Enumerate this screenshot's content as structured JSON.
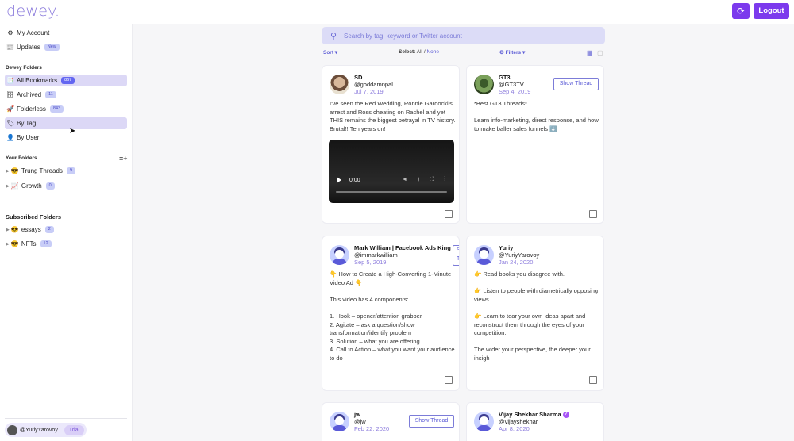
{
  "app": {
    "logo": "dewey.",
    "logout_label": "Logout"
  },
  "sidebar": {
    "top_items": [
      {
        "label": "My Account",
        "icon": "⚙"
      },
      {
        "label": "Updates",
        "icon": "📰",
        "badge": "New"
      }
    ],
    "dewey_folders_title": "Dewey Folders",
    "dewey_folders": [
      {
        "label": "All Bookmarks",
        "icon": "📑",
        "badge": "867"
      },
      {
        "label": "Archived",
        "icon": "🗄",
        "badge": "11"
      },
      {
        "label": "Folderless",
        "icon": "🚀",
        "badge": "843"
      },
      {
        "label": "By Tag",
        "icon": "🏷"
      },
      {
        "label": "By User",
        "icon": "👤"
      }
    ],
    "your_folders_title": "Your Folders",
    "your_folders": [
      {
        "label": "Trung Threads",
        "icon": "😎",
        "badge": "9"
      },
      {
        "label": "Growth",
        "icon": "📈",
        "badge": "0"
      }
    ],
    "subscribed_title": "Subscribed Folders",
    "subscribed_folders": [
      {
        "label": "essays",
        "icon": "😎",
        "badge": "2"
      },
      {
        "label": "NFTs",
        "icon": "😎",
        "badge": "12"
      }
    ],
    "user": {
      "handle": "@YuriyYarovoy",
      "plan": "Trial"
    }
  },
  "search": {
    "placeholder": "Search by tag, keyword or Twitter account"
  },
  "toolbar": {
    "sort_label": "Sort ▾",
    "select_label": "Select:",
    "select_all": "All",
    "select_sep": " / ",
    "select_none": "None",
    "filters_label": "⚙ Filters ▾"
  },
  "cards": [
    {
      "name": "SD",
      "handle": "@goddamnpal",
      "date": "Jul 7, 2019",
      "body": "I've seen the Red Wedding, Ronnie Gardocki's arrest and Ross cheating on Rachel and yet THIS remains the biggest betrayal in TV history. Brutal!! Ten years on!",
      "video_time": "0:00"
    },
    {
      "name": "GT3",
      "handle": "@GT3TV",
      "date": "Sep 4, 2019",
      "thread_label": "Show Thread",
      "body": "*Best GT3 Threads*\n\nLearn info-marketing, direct response, and how to make baller sales funnels ⬇️"
    },
    {
      "name": "Mark William | Facebook Ads King",
      "handle": "@immarkwilliam",
      "date": "Sep 5, 2019",
      "thread_label": "Show Thread",
      "body": "👇 How to Create a High-Converting 1-Minute Video Ad 👇\n\nThis video has 4 components:\n\n1. Hook – opener/attention grabber\n2. Agitate – ask a question/show transformation/identify problem\n3. Solution – what you are offering\n4. Call to Action – what you want your audience to do"
    },
    {
      "name": "Yuriy",
      "handle": "@YuriyYarovoy",
      "date": "Jan 24, 2020",
      "body": "👉 Read books you disagree with.\n\n👉 Listen to people with diametrically opposing views.\n\n👉 Learn to tear your own ideas apart and reconstruct them through the eyes of your competition.\n\nThe wider your perspective, the deeper your insigh"
    },
    {
      "name": "jw",
      "handle": "@jw",
      "date": "Feb 22, 2020",
      "thread_label": "Show Thread"
    },
    {
      "name": "Vijay Shekhar Sharma",
      "handle": "@vijayshekhar",
      "date": "Apr 8, 2020"
    }
  ]
}
